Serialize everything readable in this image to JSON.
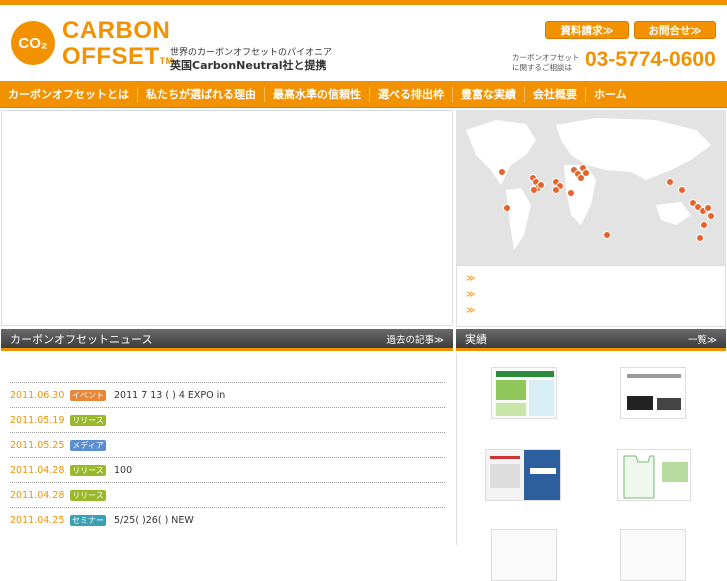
{
  "brand": {
    "logo_mark": "CO₂",
    "line1": "CARBON",
    "line2": "OFFSET",
    "tm": "TM",
    "tagline1": "世界のカーボンオフセットのパイオニア",
    "tagline2": "英国CarbonNeutral社と提携"
  },
  "header": {
    "request_btn": "資料請求≫",
    "contact_btn": "お問合せ≫",
    "phone_label_1": "カーボンオフセット",
    "phone_label_2": "に関するご相談は",
    "phone": "03-5774-0600"
  },
  "nav": [
    "カーボンオフセットとは",
    "私たちが選ばれる理由",
    "最高水準の信頼性",
    "選べる排出枠",
    "豊富な実績",
    "会社概要",
    "ホーム"
  ],
  "map_links": [
    "≫",
    "≫",
    "≫"
  ],
  "news": {
    "title": "カーボンオフセットニュース",
    "more": "過去の記事≫",
    "items": [
      {
        "date": "2011.06.30",
        "badge": "イベント",
        "text": "2011 7 13 (  )        4              EXPO in"
      },
      {
        "date": "2011.05.19",
        "badge": "リリース",
        "text": ""
      },
      {
        "date": "2011.05.25",
        "badge": "メディア",
        "text": ""
      },
      {
        "date": "2011.04.28",
        "badge": "リリース",
        "text": "100"
      },
      {
        "date": "2011.04.28",
        "badge": "リリース",
        "text": ""
      },
      {
        "date": "2011.04.25",
        "badge": "セミナー",
        "text": "5/25(  )26(  ) NEW"
      }
    ]
  },
  "works": {
    "title": "実績",
    "more": "一覧≫"
  },
  "colors": {
    "accent": "#f39200",
    "event": "#e8873a",
    "release": "#9ab82c",
    "media": "#5a8ed0",
    "seminar": "#3ba0b4"
  }
}
